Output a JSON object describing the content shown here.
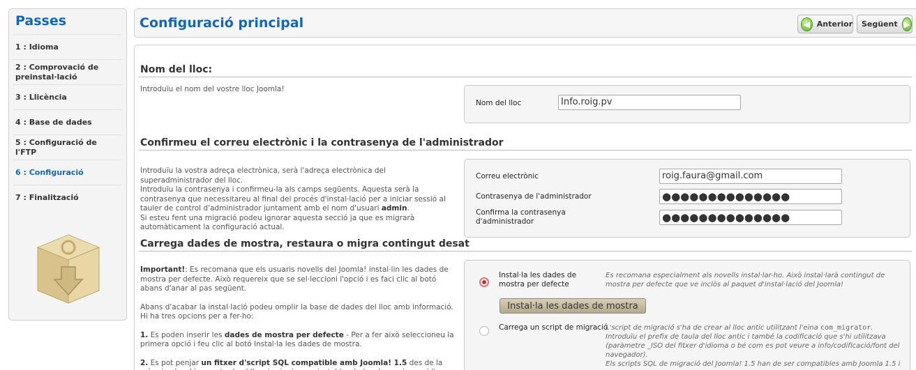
{
  "sidebar": {
    "title": "Passes",
    "steps": [
      {
        "label": "1 : Idioma"
      },
      {
        "label": "2 : Comprovació de preinstal·lació"
      },
      {
        "label": "3 : Llicència"
      },
      {
        "label": "4 : Base de dades"
      },
      {
        "label": "5 : Configuració de l'FTP"
      },
      {
        "label": "6 : Configuració"
      },
      {
        "label": "7 : Finalització"
      }
    ],
    "active_step": 5
  },
  "header": {
    "title": "Configuració principal",
    "prev_label": "Anterior",
    "next_label": "Següent"
  },
  "site": {
    "title": "Nom del lloc:",
    "description": "Introduïu el nom del vostre lloc Joomla!",
    "field_label": "Nom del lloc",
    "field_value": "Info.roig.pv"
  },
  "admin": {
    "title": "Confirmeu el correu electrònic i la contrasenya de l'administrador",
    "desc_1": "Introduïu la vostra adreça electrònica, serà l'adreça electrònica del superadministrador del lloc.",
    "desc_2a": "Introduïu la contrasenya i confirmeu-la als camps següents. Aquesta serà la contrasenya que necessitareu al final del procés d'instal·lació per a iniciar sessió al tauler de control d'administrador juntament amb el nom d'usuari ",
    "desc_2b": "admin",
    "desc_2c": ".",
    "desc_3": "Si esteu fent una migració podeu ignorar aquesta secció ja que es migrarà automàticament la configuració actual.",
    "email_label": "Correu electrònic",
    "email_value": "roig.faura@gmail.com",
    "password_label": "Contrasenya de l'administrador",
    "password_value": "●●●●●●●●●●●●●●",
    "confirm_label": "Confirma la contrasenya d'administrador",
    "confirm_value": "●●●●●●●●●●●●●●"
  },
  "sample": {
    "title": "Carrega dades de mostra, restaura o migra contingut desat",
    "p1_b": "Important!",
    "p1": ": Es recomana que els usuaris novells del Joomla! instal·lin les dades de mostra per defecte. Això requereix que se sel·leccioni l'opció i es faci clic al botó abans d'anar al pas següent.",
    "p2": "Abans d'acabar la instal·lació podeu omplir la base de dades del lloc amb informació. Hi ha tres opcions per a fer-ho:",
    "p3_a": "1.",
    "p3_b": " Es poden inserir les ",
    "p3_c": "dades de mostra per defecte",
    "p3_d": " - Per a fer això seleccioneu la primera opció i feu clic al botó Instal·la les dades de mostra.",
    "p4_a": "2.",
    "p4_b": " Es pot penjar ",
    "p4_c": "un fitxer d'script SQL compatible amb Joomla! 1.5",
    "p4_d": " des de la màquina local i executar-lo al lloc, ja sigui per a instal·lar dades de mostra en idioma propi, ja sigui",
    "opt1_label": "Instal·la les dades de mostra per defecte",
    "opt1_desc": "Es recomana especialment als novells instal·lar-ho. Això instal·larà contingut de mostra per defecte que ve inclòs al paquet d'instal·lació del Joomla!",
    "install_button": "Instal·la les dades de mostra",
    "opt2_label": "Carrega un script de migració",
    "opt2_desc_a": "L'script de migració s'ha de crear al lloc antic utilitzant l'eina ",
    "opt2_desc_code": "com_migrator",
    "opt2_desc_b": ". Introduïu el prefix de taula del lloc antic i també la codificació que s'hi utilitzava (paràmetre _ISO del fitxer d'idioma o bé com es pot veure a info/codificació/font del navegador).",
    "opt2_desc_c": "Els scripts SQL de migració del Joomla! 1.5 han de ser compatibles amb Joomla 1.5 i"
  }
}
